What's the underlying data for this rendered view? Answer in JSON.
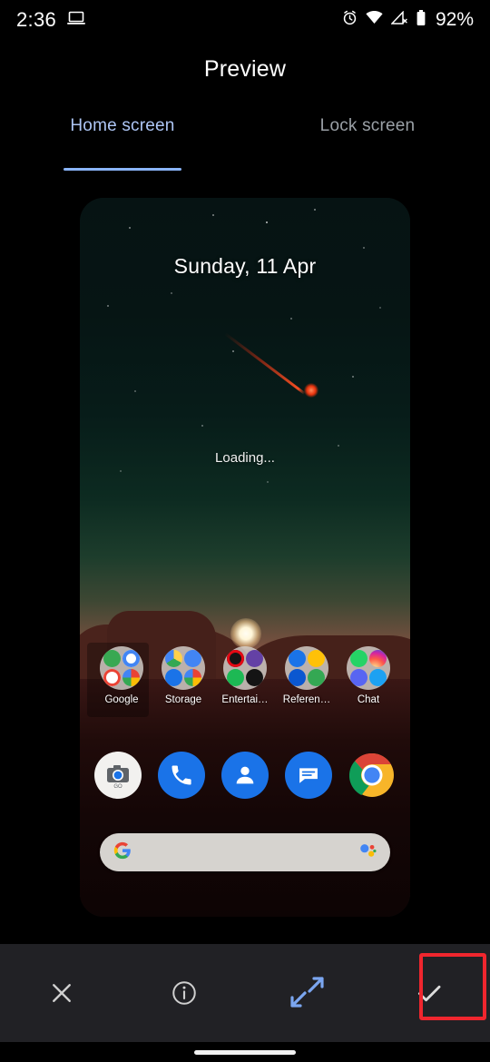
{
  "status_bar": {
    "time": "2:36",
    "battery_percent": "92%",
    "icons": [
      "laptop-cast-icon",
      "alarm-icon",
      "wifi-icon",
      "mobile-data-off-icon",
      "battery-icon"
    ]
  },
  "header": {
    "title": "Preview"
  },
  "tabs": [
    {
      "label": "Home screen",
      "active": true
    },
    {
      "label": "Lock screen",
      "active": false
    }
  ],
  "preview": {
    "wallpaper_name": "meteor-sunset-wallpaper",
    "date": "Sunday, 11 Apr",
    "loading_text": "Loading...",
    "folders": [
      {
        "label": "Google",
        "apps": [
          "play-store-icon",
          "google-g-icon",
          "gmail-icon",
          "photos-icon"
        ],
        "colors": [
          "#38a852",
          "#4285f4",
          "#ea4335",
          "#fbbc05"
        ]
      },
      {
        "label": "Storage",
        "apps": [
          "drive-icon",
          "files-icon",
          "drive-backup-icon",
          "photos-icon"
        ],
        "colors": [
          "#ffd04b",
          "#4285f4",
          "#1a73e8",
          "#34a853"
        ]
      },
      {
        "label": "Entertai…",
        "apps": [
          "netflix-icon",
          "twitch-icon",
          "spotify-icon",
          "play-video-icon"
        ],
        "colors": [
          "#1a1a1a",
          "#6441a5",
          "#1db954",
          "#141414"
        ]
      },
      {
        "label": "Referen…",
        "apps": [
          "classroom-icon",
          "duolingo-icon",
          "play-books-icon",
          "keep-icon"
        ],
        "colors": [
          "#1a73e8",
          "#ffc107",
          "#0b57d0",
          "#34a853"
        ]
      },
      {
        "label": "Chat",
        "apps": [
          "whatsapp-icon",
          "instagram-icon",
          "discord-icon",
          "twitter-icon"
        ],
        "colors": [
          "#25d366",
          "#e1306c",
          "#5865f2",
          "#1da1f2"
        ]
      }
    ],
    "dock": [
      {
        "label": "Camera Go",
        "icon": "camera-go-icon"
      },
      {
        "label": "Phone",
        "icon": "phone-icon"
      },
      {
        "label": "Contacts",
        "icon": "contacts-icon"
      },
      {
        "label": "Messages",
        "icon": "messages-icon"
      },
      {
        "label": "Chrome",
        "icon": "chrome-icon"
      }
    ],
    "search_bar": {
      "left_icon": "google-g-icon",
      "right_icon": "google-assistant-icon",
      "value": "",
      "placeholder": ""
    }
  },
  "toolbar": {
    "buttons": [
      {
        "name": "close-button",
        "icon": "close-icon",
        "label": "Close"
      },
      {
        "name": "info-button",
        "icon": "info-icon",
        "label": "Info"
      },
      {
        "name": "expand-button",
        "icon": "expand-icon",
        "label": "Expand"
      },
      {
        "name": "apply-button",
        "icon": "checkmark-icon",
        "label": "Apply",
        "highlighted": true
      }
    ]
  },
  "colors": {
    "accent_blue": "#8ab4f8",
    "tab_active": "#aec6f5",
    "tab_inactive": "#9aa0a6",
    "toolbar_bg": "#212125",
    "highlight_red": "#f0262e",
    "expand_icon_blue": "#7ba6f0"
  },
  "nav_bar": {
    "indicator": "home-indicator"
  }
}
